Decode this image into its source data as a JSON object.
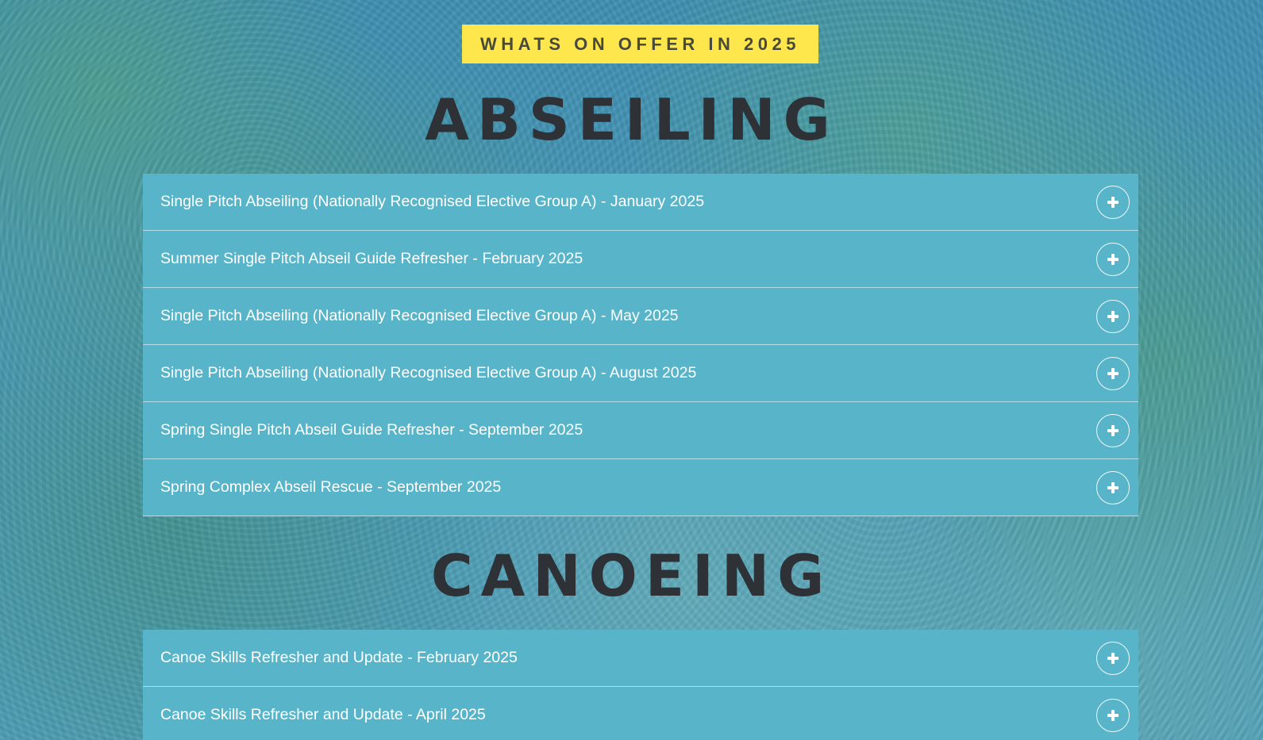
{
  "tagline": "WHATS ON OFFER IN 2025",
  "colors": {
    "tagline_bg": "#fde74c",
    "accordion_bg": "#58b5c9",
    "heading_text": "#2e3136"
  },
  "sections": {
    "abseiling": {
      "title": "ABSEILING",
      "items": [
        {
          "label": "Single Pitch Abseiling (Nationally Recognised Elective Group A) - January 2025",
          "icon": "plus-icon"
        },
        {
          "label": "Summer Single Pitch Abseil Guide Refresher - February 2025",
          "icon": "plus-icon"
        },
        {
          "label": "Single Pitch Abseiling (Nationally Recognised Elective Group A) - May 2025",
          "icon": "plus-icon"
        },
        {
          "label": "Single Pitch Abseiling (Nationally Recognised Elective Group A) - August 2025",
          "icon": "plus-icon"
        },
        {
          "label": "Spring Single Pitch Abseil Guide Refresher - September 2025",
          "icon": "plus-icon"
        },
        {
          "label": "Spring Complex Abseil Rescue - September 2025",
          "icon": "plus-icon"
        }
      ]
    },
    "canoeing": {
      "title": "CANOEING",
      "items": [
        {
          "label": "Canoe Skills Refresher and Update - February 2025",
          "icon": "plus-icon"
        },
        {
          "label": "Canoe Skills Refresher and Update - April 2025",
          "icon": "plus-icon"
        }
      ]
    }
  }
}
